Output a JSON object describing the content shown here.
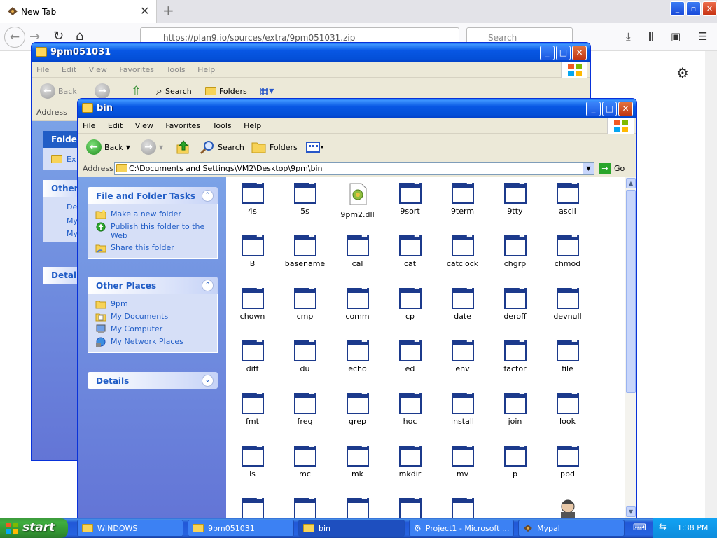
{
  "browser": {
    "tab_title": "New Tab",
    "url": "https://plan9.io/sources/extra/9pm051031.zip",
    "search_placeholder": "Search"
  },
  "back_window": {
    "title": "9pm051031",
    "menu": [
      "File",
      "Edit",
      "View",
      "Favorites",
      "Tools",
      "Help"
    ],
    "toolbar": {
      "back": "Back",
      "search": "Search",
      "folders": "Folders"
    },
    "address_label": "Address",
    "pane_titles": [
      "Folder",
      "Other",
      "Details"
    ],
    "pane_items": [
      "Ex",
      "De",
      "My",
      "My"
    ]
  },
  "window": {
    "title": "bin",
    "menu": [
      "File",
      "Edit",
      "View",
      "Favorites",
      "Tools",
      "Help"
    ],
    "toolbar": {
      "back": "Back",
      "search": "Search",
      "folders": "Folders"
    },
    "address_label": "Address",
    "address": "C:\\Documents and Settings\\VM2\\Desktop\\9pm\\bin",
    "go": "Go"
  },
  "taskpane": {
    "file_tasks": {
      "title": "File and Folder Tasks",
      "items": [
        "Make a new folder",
        "Publish this folder to the Web",
        "Share this folder"
      ]
    },
    "other_places": {
      "title": "Other Places",
      "items": [
        "9pm",
        "My Documents",
        "My Computer",
        "My Network Places"
      ]
    },
    "details": {
      "title": "Details"
    }
  },
  "files": [
    "4s",
    "5s",
    "9pm2.dll",
    "9sort",
    "9term",
    "9tty",
    "ascii",
    "B",
    "basename",
    "cal",
    "cat",
    "catclock",
    "chgrp",
    "chmod",
    "chown",
    "cmp",
    "comm",
    "cp",
    "date",
    "deroff",
    "devnull",
    "diff",
    "du",
    "echo",
    "ed",
    "env",
    "factor",
    "file",
    "fmt",
    "freq",
    "grep",
    "hoc",
    "install",
    "join",
    "look",
    "ls",
    "mc",
    "mk",
    "mkdir",
    "mv",
    "p",
    "pbd"
  ],
  "taskbar": {
    "start": "start",
    "buttons": [
      "WINDOWS",
      "9pm051031",
      "bin",
      "Project1 - Microsoft ...",
      "Mypal"
    ],
    "clock": "1:38 PM"
  }
}
